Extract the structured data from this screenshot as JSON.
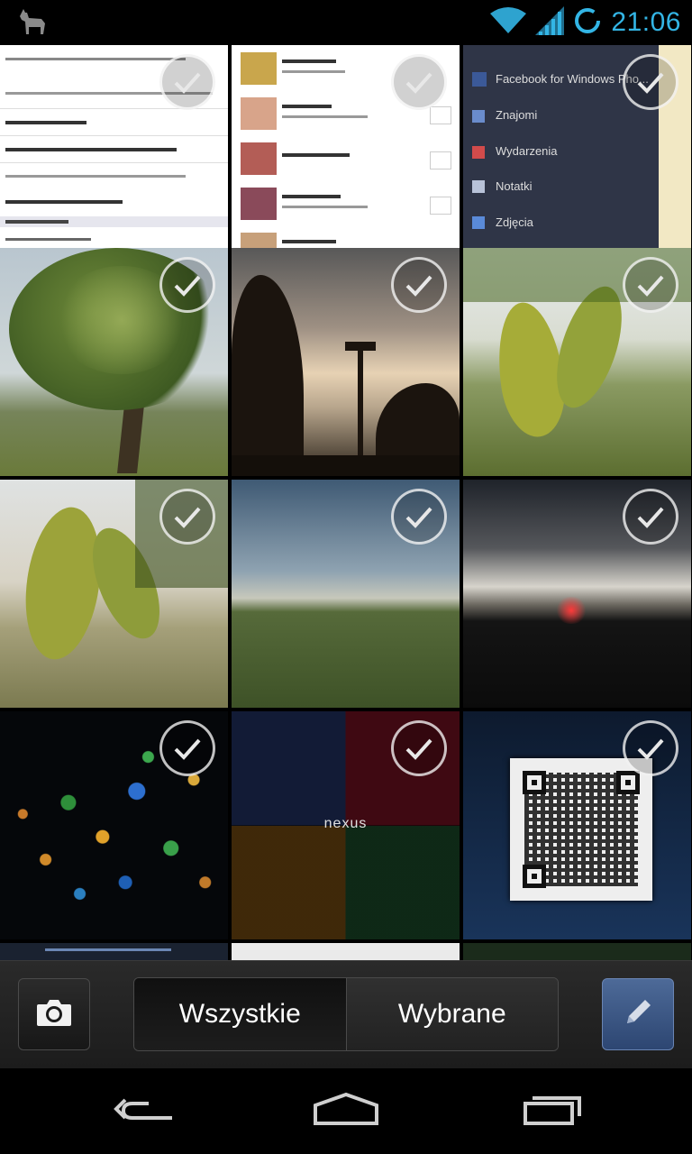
{
  "status_bar": {
    "app_icon": "llama-icon",
    "wifi_icon": "wifi-icon",
    "signal_icon": "cell-signal-icon",
    "sync_icon": "sync-ring-icon",
    "time": "21:06"
  },
  "gallery": {
    "tiles": [
      {
        "kind": "screenshot-text-list",
        "selected": true
      },
      {
        "kind": "screenshot-contacts",
        "selected": true
      },
      {
        "kind": "screenshot-facebook-menu",
        "selected": true,
        "menu_items": [
          "Facebook for Windows Pho...",
          "Znajomi",
          "Wydarzenia",
          "Notatki",
          "Zdjęcia"
        ]
      },
      {
        "kind": "photo-tree",
        "selected": true
      },
      {
        "kind": "photo-sunset-silhouette",
        "selected": true
      },
      {
        "kind": "photo-leaf",
        "selected": true
      },
      {
        "kind": "photo-leaf-field",
        "selected": true
      },
      {
        "kind": "photo-field-evening",
        "selected": true
      },
      {
        "kind": "photo-sunset-horizon",
        "selected": true
      },
      {
        "kind": "photo-bokeh-dots",
        "selected": true
      },
      {
        "kind": "wallpaper-nexus4",
        "selected": true,
        "caption": "nexus"
      },
      {
        "kind": "photo-qr-code",
        "selected": true
      }
    ]
  },
  "bottom_bar": {
    "camera_icon": "camera-icon",
    "tabs": [
      {
        "label": "Wszystkie",
        "active": true
      },
      {
        "label": "Wybrane",
        "active": false
      }
    ],
    "edit_icon": "pencil-icon"
  },
  "nav_bar": {
    "back_icon": "back-arrow-icon",
    "home_icon": "home-icon",
    "recents_icon": "recent-apps-icon"
  }
}
